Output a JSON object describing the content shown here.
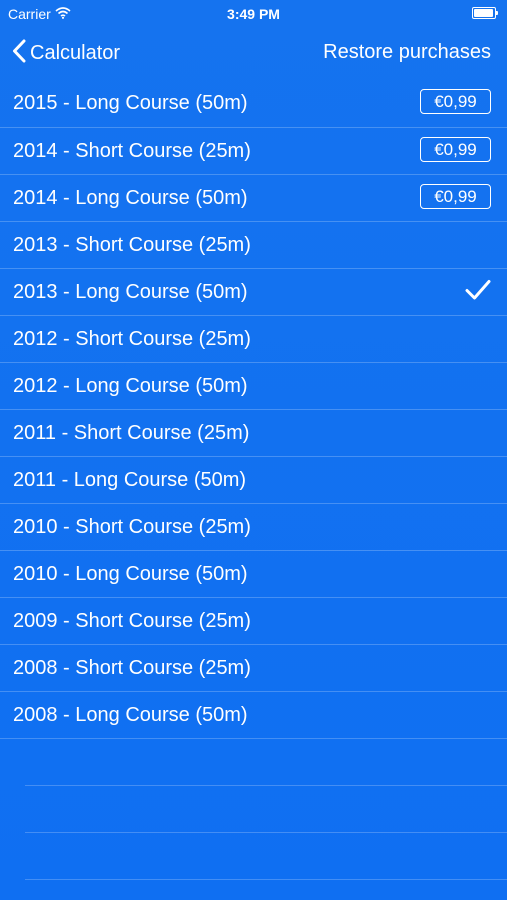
{
  "status_bar": {
    "carrier": "Carrier",
    "time": "3:49 PM"
  },
  "nav": {
    "back_label": "Calculator",
    "restore_label": "Restore purchases"
  },
  "list": {
    "items": [
      {
        "label": "2015 - Long Course (50m)",
        "price": "€0,99"
      },
      {
        "label": "2014 - Short Course (25m)",
        "price": "€0,99"
      },
      {
        "label": "2014 - Long Course (50m)",
        "price": "€0,99"
      },
      {
        "label": "2013 - Short Course (25m)"
      },
      {
        "label": "2013 - Long Course (50m)",
        "selected": true
      },
      {
        "label": "2012 - Short Course (25m)"
      },
      {
        "label": "2012 - Long Course (50m)"
      },
      {
        "label": "2011 - Short Course (25m)"
      },
      {
        "label": "2011 - Long Course (50m)"
      },
      {
        "label": "2010 - Short Course (25m)"
      },
      {
        "label": "2010 - Long Course (50m)"
      },
      {
        "label": "2009 - Short Course (25m)"
      },
      {
        "label": "2008 - Short Course (25m)"
      },
      {
        "label": "2008 - Long Course (50m)"
      }
    ]
  },
  "icons": {
    "back": "chevron-left-icon",
    "wifi": "wifi-icon",
    "battery": "battery-icon",
    "selected": "checkmark-icon"
  },
  "colors": {
    "background": "#1273f0",
    "text": "#ffffff"
  }
}
